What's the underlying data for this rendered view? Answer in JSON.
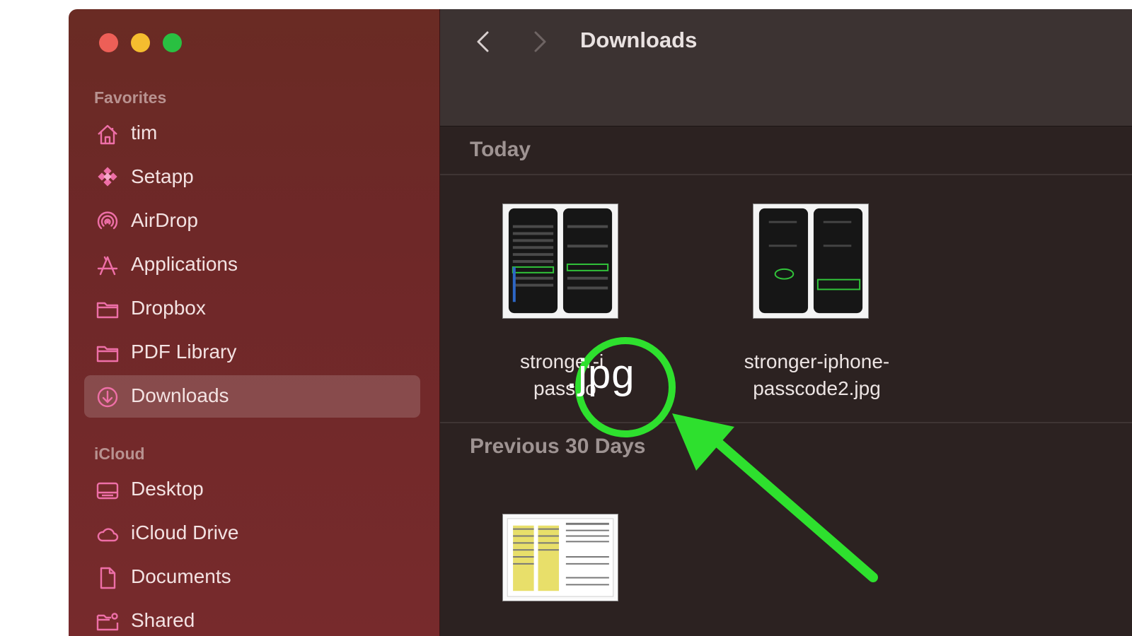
{
  "window": {
    "title": "Downloads"
  },
  "sidebar": {
    "sections": [
      {
        "label": "Favorites",
        "items": [
          {
            "label": "tim",
            "icon": "home-icon"
          },
          {
            "label": "Setapp",
            "icon": "setapp-icon"
          },
          {
            "label": "AirDrop",
            "icon": "airdrop-icon"
          },
          {
            "label": "Applications",
            "icon": "applications-icon"
          },
          {
            "label": "Dropbox",
            "icon": "folder-icon"
          },
          {
            "label": "PDF Library",
            "icon": "folder-icon"
          },
          {
            "label": "Downloads",
            "icon": "downloads-icon",
            "selected": true
          }
        ]
      },
      {
        "label": "iCloud",
        "items": [
          {
            "label": "Desktop",
            "icon": "desktop-icon"
          },
          {
            "label": "iCloud Drive",
            "icon": "cloud-icon"
          },
          {
            "label": "Documents",
            "icon": "document-icon"
          },
          {
            "label": "Shared",
            "icon": "shared-folder-icon"
          }
        ]
      }
    ]
  },
  "groups": [
    {
      "header": "Today",
      "files": [
        {
          "name_line1": "stronger-i",
          "name_line2": "passco"
        },
        {
          "name_line1": "stronger-iphone-",
          "name_line2": "passcode2.jpg"
        }
      ]
    },
    {
      "header": "Previous 30 Days",
      "files": [
        {
          "name_line1": "",
          "name_line2": ""
        }
      ]
    }
  ],
  "annotation": {
    "callout_text": ".jpg",
    "color": "#2ee02e"
  },
  "colors": {
    "accent_icon": "#ee6fa7",
    "sidebar_bg": "#6e2828",
    "main_bg": "#2c2221"
  }
}
